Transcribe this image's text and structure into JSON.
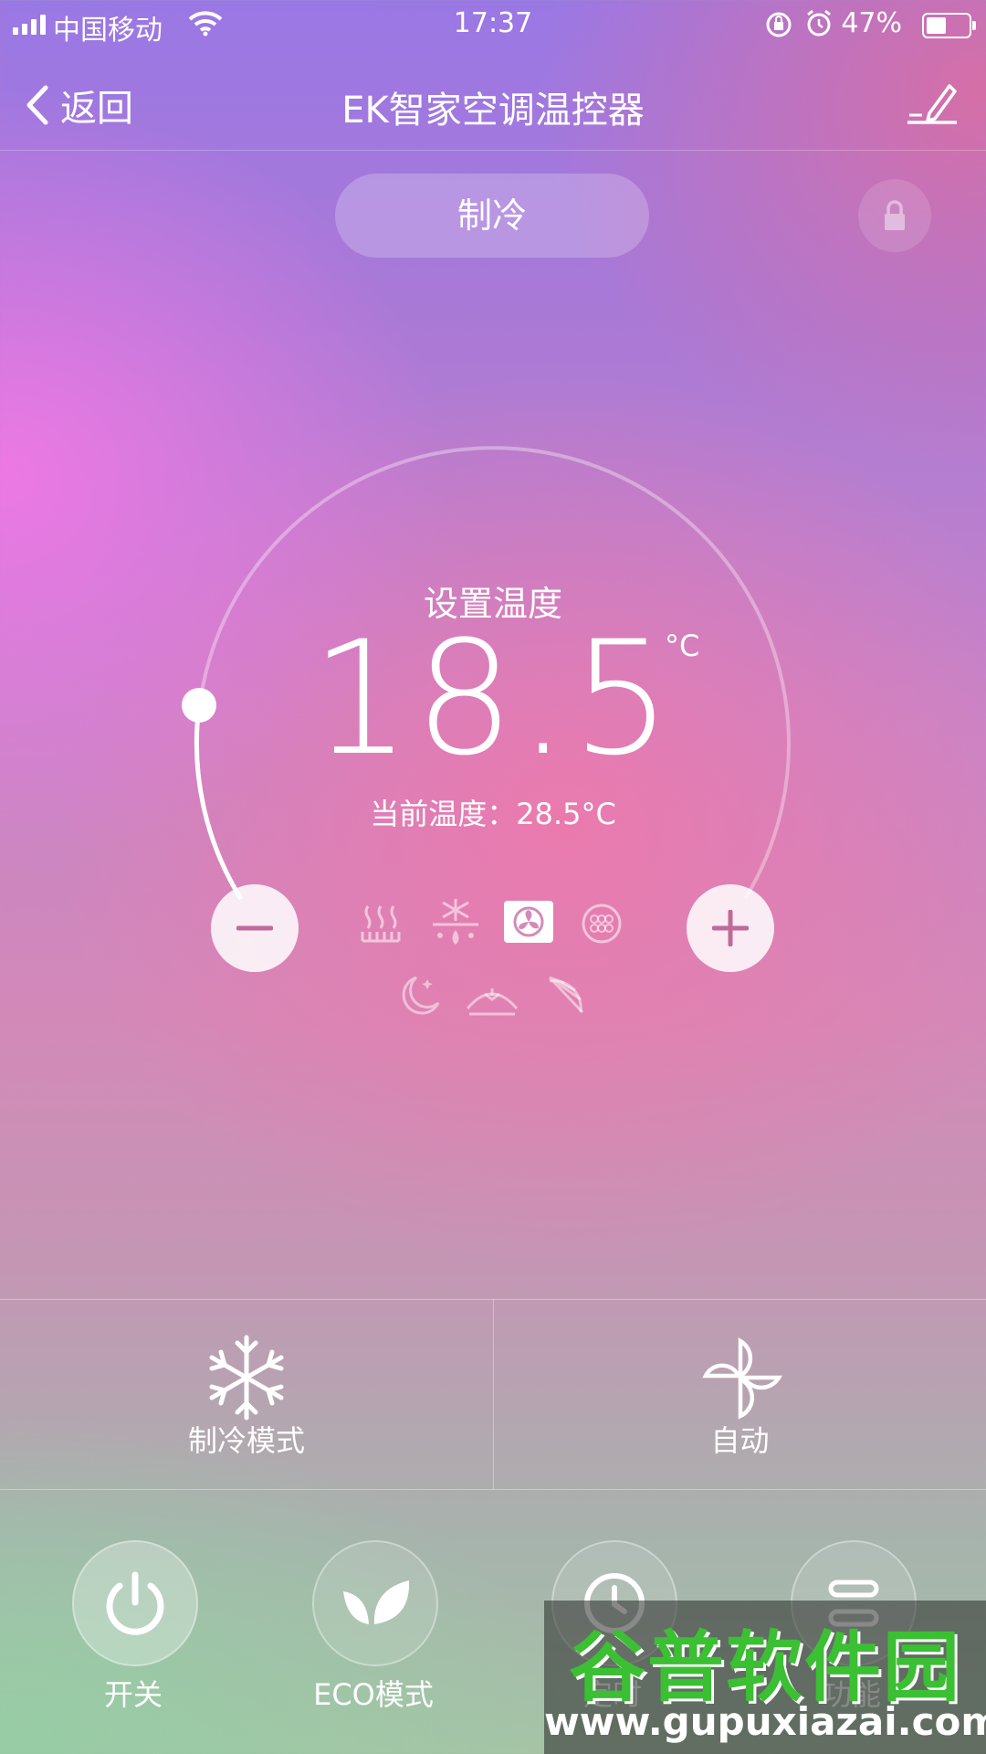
{
  "status_bar": {
    "carrier": "中国移动",
    "time": "17:37",
    "battery_percent": "47%",
    "battery_level": 0.47
  },
  "nav": {
    "back_label": "返回",
    "title": "EK智家空调温控器"
  },
  "mode_pill": {
    "label": "制冷"
  },
  "dial": {
    "set_label": "设置温度",
    "set_temp": "18.5",
    "unit": "°C",
    "current_temp_label": "当前温度：28.5°C"
  },
  "modes": {
    "row1": [
      "heat-icon",
      "cool-dry-icon",
      "fan-icon",
      "filter-icon"
    ],
    "row2": [
      "sleep-icon",
      "swing-icon",
      "sun-icon"
    ],
    "active": "fan-icon"
  },
  "panel": {
    "left_label": "制冷模式",
    "right_label": "自动"
  },
  "bottom_buttons": [
    {
      "label": "开关"
    },
    {
      "label": "ECO模式"
    },
    {
      "label": "定时"
    },
    {
      "label": "功能"
    }
  ],
  "watermark": {
    "text": "谷普软件园",
    "url": "www.gupuxiazai.com"
  },
  "colors": {
    "text": "#ffffff",
    "watermark_green": "#3bbf33",
    "button_icon": "#c06a9a"
  }
}
